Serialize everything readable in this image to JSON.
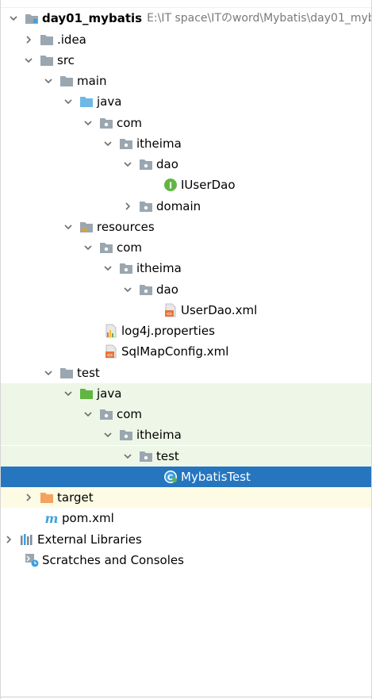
{
  "project": {
    "name": "day01_mybatis",
    "path": "E:\\IT space\\ITのword\\Mybatis\\day01_myb"
  },
  "nodes": {
    "idea": ".idea",
    "src": "src",
    "main": "main",
    "main_java": "java",
    "main_com": "com",
    "main_itheima": "itheima",
    "main_dao": "dao",
    "iuserdao": "IUserDao",
    "domain": "domain",
    "resources": "resources",
    "res_com": "com",
    "res_itheima": "itheima",
    "res_dao": "dao",
    "userdao_xml": "UserDao.xml",
    "log4j": "log4j.properties",
    "sqlmapconfig": "SqlMapConfig.xml",
    "test": "test",
    "test_java": "java",
    "test_com": "com",
    "test_itheima": "itheima",
    "test_test": "test",
    "mybatistest": "MybatisTest",
    "target": "target",
    "pom": "pom.xml",
    "external_libraries": "External Libraries",
    "scratches": "Scratches and Consoles"
  },
  "colors": {
    "selection": "#2675bf",
    "test_background": "#eef7e7",
    "excluded_background": "#fdfbe3",
    "folder": "#9aa7b0",
    "source_folder": "#6fb8e6",
    "test_folder": "#62b543",
    "excluded_folder": "#f4a261",
    "interface_icon": "#62b543"
  }
}
